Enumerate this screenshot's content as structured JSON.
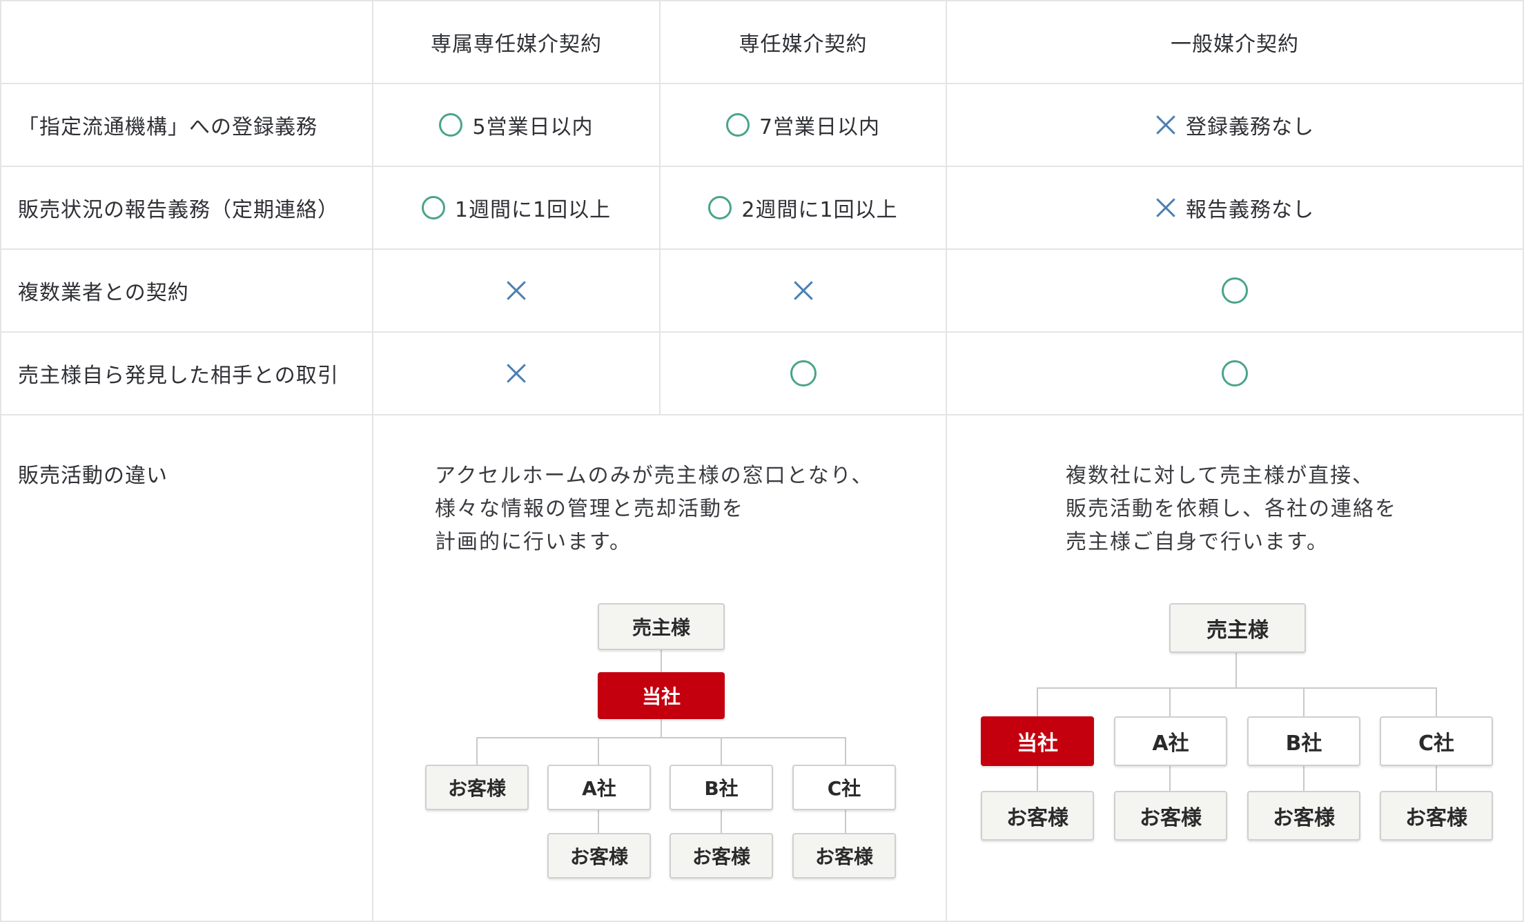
{
  "header": {
    "col1": "専属専任媒介契約",
    "col2": "専任媒介契約",
    "col3": "一般媒介契約"
  },
  "rows": [
    {
      "label": "「指定流通機構」への登録義務",
      "c1_mark": "circle",
      "c1_text": "5営業日以内",
      "c2_mark": "circle",
      "c2_text": "7営業日以内",
      "c3_mark": "cross",
      "c3_text": "登録義務なし"
    },
    {
      "label": "販売状況の報告義務（定期連絡）",
      "c1_mark": "circle",
      "c1_text": "1週間に1回以上",
      "c2_mark": "circle",
      "c2_text": "2週間に1回以上",
      "c3_mark": "cross",
      "c3_text": "報告義務なし"
    },
    {
      "label": "複数業者との契約",
      "c1_mark": "cross",
      "c2_mark": "cross",
      "c3_mark": "circle"
    },
    {
      "label": "売主様自ら発見した相手との取引",
      "c1_mark": "cross",
      "c2_mark": "circle",
      "c3_mark": "circle"
    }
  ],
  "activity": {
    "label": "販売活動の違い",
    "exclusive_desc": "アクセルホームのみが売主様の窓口となり、\n様々な情報の管理と売却活動を\n計画的に行います。",
    "general_desc": "複数社に対して売主様が直接、\n販売活動を依頼し、各社の連絡を\n売主様ご自身で行います。"
  },
  "diagram": {
    "seller": "売主様",
    "our_company": "当社",
    "company_a": "A社",
    "company_b": "B社",
    "company_c": "C社",
    "customer": "お客様"
  },
  "colors": {
    "circle": "#4aa38a",
    "cross": "#4a7fb2",
    "our_company": "#c4000f"
  }
}
